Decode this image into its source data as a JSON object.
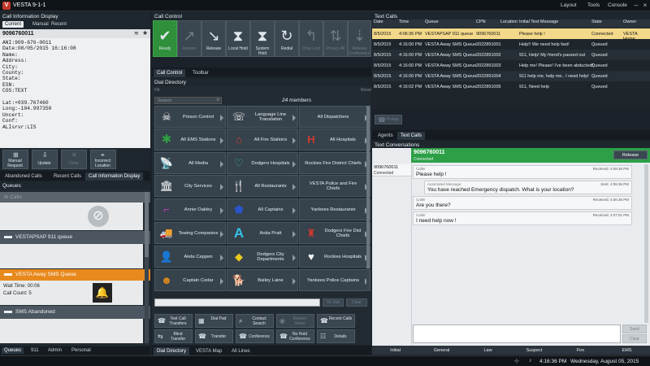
{
  "app": {
    "title": "VESTA 9-1-1",
    "menus": [
      "Layout",
      "Tools",
      "Console"
    ]
  },
  "call_info": {
    "section_title": "Call Information Display",
    "tabs": [
      "Current",
      "Manual",
      "Recent"
    ],
    "phone": "9096760011",
    "details": [
      "ANI:909-676-0011",
      "Date:08/05/2015 16:16:08",
      "Name:",
      "Address:",
      "City:",
      "County:",
      "State:",
      "ESN:",
      "COS:TEXT",
      "",
      "Lat:+039.767460",
      "Long:-104.997350",
      "Uncert:",
      "Conf:",
      "ALIsrvr:LIS"
    ],
    "buttons": [
      "Manual Request",
      "Update",
      "Clear",
      "Incorrect Location"
    ],
    "bottom_tabs": [
      "Abandoned Calls",
      "Recent Calls",
      "Call Information Display"
    ]
  },
  "queues": {
    "title": "Queues",
    "in_calls": "In Calls",
    "items": [
      {
        "name": "VESTAPSAP 911 queue"
      },
      {
        "name": "VESTA Away SMS Queue",
        "wait": "Wait Time: 00:06",
        "count": "Call Count: 5"
      },
      {
        "name": "SMS Abandoned"
      }
    ],
    "tabs": [
      "Queues",
      "911",
      "Admin",
      "Personal"
    ]
  },
  "call_control": {
    "title": "Call Control",
    "buttons": [
      "Ready",
      "Answer",
      "Release",
      "Local Hold",
      "System Hold",
      "Redial",
      "Drop Last",
      "Privacy All",
      "Release Conference"
    ],
    "tabs": [
      "Call Control",
      "Toolbar"
    ]
  },
  "dial_directory": {
    "title": "Dial Directory",
    "filter": "Filt",
    "reset": "Reset",
    "search_placeholder": "Search",
    "members": "24 members",
    "entries": [
      "Poison Control",
      "Language Line Translation",
      "All Dispatchers",
      "All EMS Stations",
      "All Fire Stations",
      "All Hospitals",
      "All Media",
      "Dodgers Hospitals",
      "Rockies Fire District Chiefs",
      "City Services",
      "All Restaurants",
      "VESTA Police and Fire Chiefs",
      "Annie Oakley",
      "All Captains",
      "Yankees Restaurants",
      "Towing Companies",
      "Anita Pratt",
      "Dodgers Fire Dist Chiefs",
      "Aleta Cappen",
      "Dodgers City Departments",
      "Rockies Hospitals",
      "Captain Cedar",
      "Bailey Laine",
      "Yankees Police Captains"
    ],
    "dial_buttons": [
      "On Dial",
      "Clear"
    ],
    "tool_buttons": [
      "Test Call Transfers",
      "Dial Pad",
      "Contact Search",
      "Monitor Sheet",
      "Recent Calls",
      "Blind Transfer",
      "Transfer",
      "Conference",
      "No Hold Conference",
      "Details"
    ],
    "tabs": [
      "Dial Directory",
      "VESTA Map",
      "All Lines"
    ]
  },
  "text_calls": {
    "title": "Text Calls",
    "columns": [
      "Date",
      "Time",
      "Queue",
      "CPN",
      "Location",
      "Initial Text Message",
      "State",
      "Owner"
    ],
    "rows": [
      [
        "8/5/2015",
        "4:06:36 PM",
        "VESTAPSAP 911 queue",
        "9096760011",
        "",
        "Please help !",
        "Connected",
        "VESTA Home"
      ],
      [
        "8/5/2015",
        "4:16:00 PM",
        "VESTA Away SMS Queue",
        "2022891001",
        "",
        "Help!! We need help fast!",
        "Queued",
        ""
      ],
      [
        "8/5/2015",
        "4:16:00 PM",
        "VESTA Away SMS Queue",
        "2022891002",
        "",
        "911, Help! My friend's passed out",
        "Queued",
        ""
      ],
      [
        "8/5/2015",
        "4:16:00 PM",
        "VESTA Away SMS Queue",
        "2022891003",
        "",
        "Help me! Please! I've been abducted!",
        "Queued",
        ""
      ],
      [
        "8/5/2015",
        "4:16:00 PM",
        "VESTA Away SMS Queue",
        "2022891004",
        "",
        "911 help me, help me.. I need help!",
        "Queued",
        ""
      ],
      [
        "8/5/2015",
        "4:16:02 PM",
        "VESTA Away SMS Queue",
        "2022891005",
        "",
        "911, Need help",
        "Queued",
        ""
      ]
    ],
    "pickup": "Pickup",
    "tabs": [
      "Agents",
      "Text Calls"
    ]
  },
  "conversation": {
    "title": "Text Conversations",
    "number": "9096760011",
    "status": "Connected",
    "release": "Release",
    "side_number": "9096760011",
    "side_status": "Connected",
    "messages": [
      {
        "who": "Caller",
        "when": "Received: 4:06:36 PM",
        "text": "Please help !"
      },
      {
        "who": "Automated Message",
        "when": "Sent: 4:06:36 PM",
        "text": "You have reached Emergency dispatch. What is your location?"
      },
      {
        "who": "Caller",
        "when": "Received: 4:06:36 PM",
        "text": "Are you there?"
      },
      {
        "who": "Caller",
        "when": "Received: 4:07:01 PM",
        "text": "I need help now !"
      }
    ],
    "send": "Send",
    "clear": "Clear",
    "quick_tabs": [
      "Initial",
      "General",
      "Law",
      "Suspect",
      "Fire",
      "EMS"
    ]
  },
  "status_bar": {
    "time": "4:16:36 PM",
    "date": "Wednesday, August 05, 2015"
  }
}
